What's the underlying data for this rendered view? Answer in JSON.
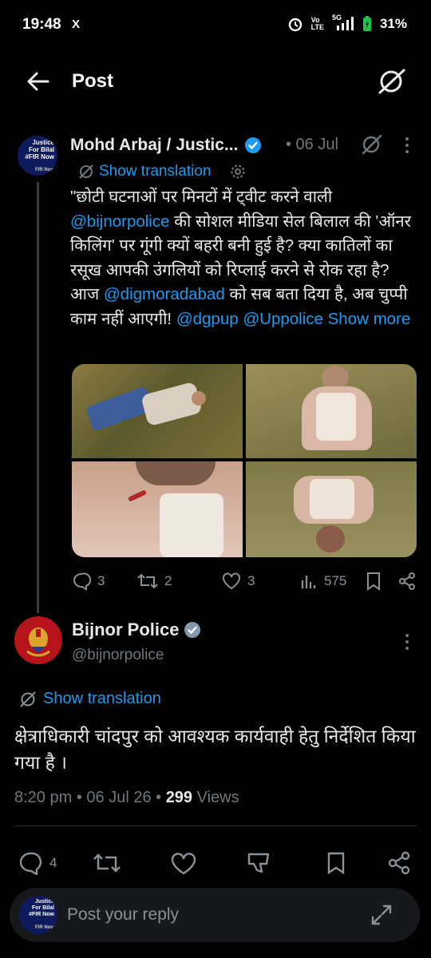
{
  "status": {
    "time": "19:48",
    "x_label": "X",
    "vo": "Vo",
    "lte": "LTE",
    "net": "5G",
    "battery": "31%"
  },
  "header": {
    "title": "Post"
  },
  "parent": {
    "avatar_lines": [
      "Justice",
      "For Bilal",
      "#FIR Now",
      "FIR Now"
    ],
    "author": "Mohd Arbaj / Justic...",
    "date": "• 06 Jul",
    "show_translation": "Show translation",
    "text_parts": [
      "\"छोटी घटनाओं पर मिनटों में ट्वीट करने वाली ",
      "@bijnorpolice",
      " की सोशल मीडिया सेल बिलाल की 'ऑनर किलिंग' पर गूंगी क्यों बहरी बनी हुई है? क्या कातिलों का रसूख आपकी उंगलियों को रिप्लाई करने से रोक रहा है? आज ",
      "@digmoradabad",
      " को सब बता दिया है, अब चुप्पी काम नहीं आएगी! ",
      "@dgpup",
      "@Uppolice",
      "Show more"
    ],
    "stats": {
      "replies": "3",
      "reposts": "2",
      "likes": "3",
      "views": "575"
    }
  },
  "reply": {
    "author": "Bijnor Police",
    "handle": "@bijnorpolice",
    "show_translation": "Show translation",
    "text": "क्षेत्राधिकारी चांदपुर को आवश्यक कार्यवाही हेतु निर्देशित किया गया है ।",
    "time": "8:20 pm",
    "date": "06 Jul 26",
    "views_count": "299",
    "views_label": "Views",
    "replies": "4"
  },
  "composer": {
    "placeholder": "Post your reply"
  },
  "colors": {
    "background": "#000000",
    "accent": "#1d9bf0",
    "text": "#e7e9ea",
    "muted": "#71767b"
  }
}
